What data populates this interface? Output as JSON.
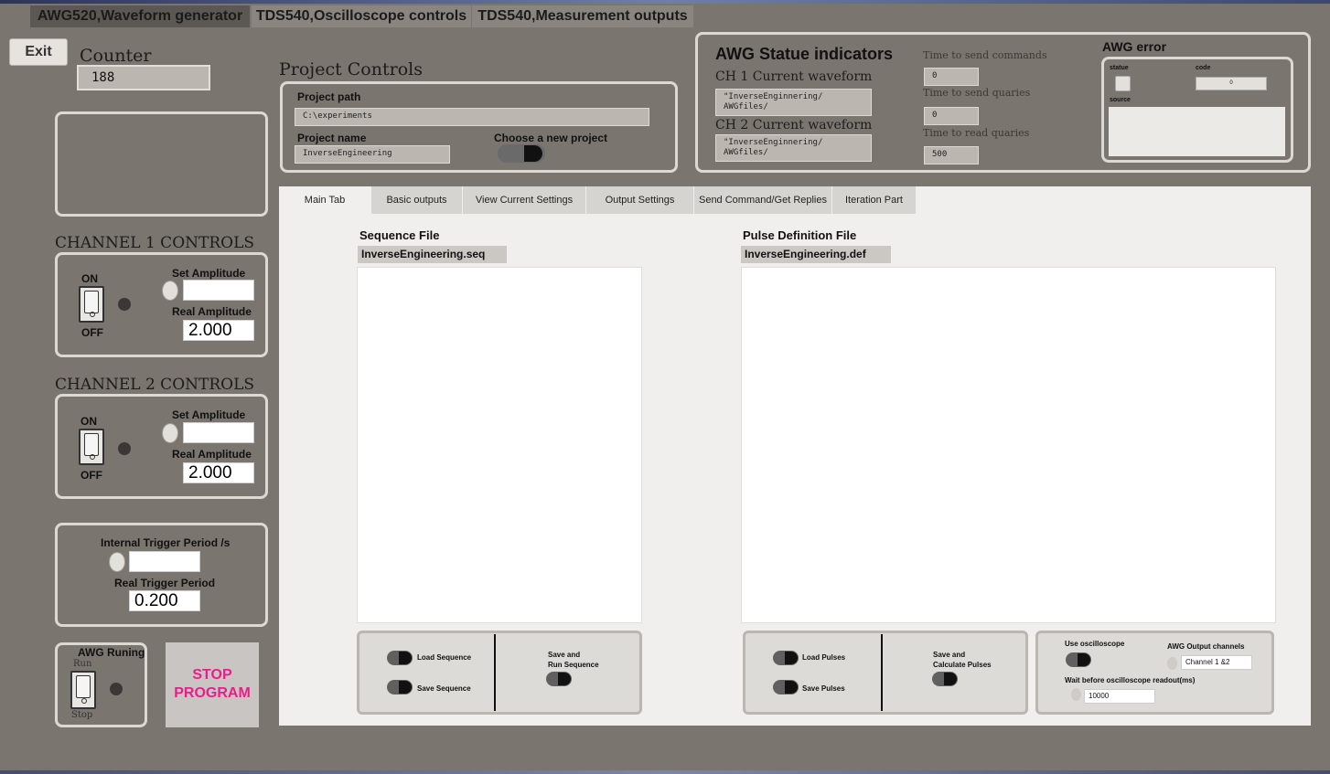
{
  "window_tabs": [
    {
      "label": "AWG520,Waveform generator"
    },
    {
      "label": "TDS540,Oscilloscope controls"
    },
    {
      "label": "TDS540,Measurement outputs"
    }
  ],
  "exit_label": "Exit",
  "counter": {
    "label": "Counter",
    "value": "188"
  },
  "project": {
    "title": "Project Controls",
    "path_label": "Project path",
    "path_value": "C:\\experiments",
    "name_label": "Project name",
    "name_value": "InverseEngineering",
    "choose_label": "Choose a new project"
  },
  "awg_status": {
    "title": "AWG Statue indicators",
    "ch1_label": "CH 1 Current waveform",
    "ch1_value": "\"InverseEnginnering/\nAWGfiles/",
    "ch2_label": "CH 2 Current waveform",
    "ch2_value": "\"InverseEnginnering/\nAWGfiles/",
    "send_cmd_label": "Time to send commands",
    "send_cmd_value": "0",
    "send_q_label": "Time to send quaries",
    "send_q_value": "0",
    "read_q_label": "Time to read quaries",
    "read_q_value": "500"
  },
  "awg_error": {
    "title": "AWG error",
    "statue_label": "statue",
    "code_label": "code",
    "code_value": "0",
    "source_label": "source"
  },
  "channel1": {
    "title": "CHANNEL 1 CONTROLS",
    "on_label": "ON",
    "off_label": "OFF",
    "set_amp_label": "Set Amplitude",
    "real_amp_label": "Real Amplitude",
    "real_amp_value": "2.000"
  },
  "channel2": {
    "title": "CHANNEL 2 CONTROLS",
    "on_label": "ON",
    "off_label": "OFF",
    "set_amp_label": "Set Amplitude",
    "real_amp_label": "Real Amplitude",
    "real_amp_value": "2.000"
  },
  "trigger": {
    "internal_label": "Internal Trigger Period /s",
    "real_label": "Real Trigger Period",
    "real_value": "0.200"
  },
  "awg_running": {
    "label": "AWG Runing",
    "run_label": "Run",
    "stop_label": "Stop"
  },
  "stop_program": {
    "line1": "STOP",
    "line2": "PROGRAM"
  },
  "tabs": [
    {
      "label": "Main Tab",
      "active": true
    },
    {
      "label": "Basic outputs"
    },
    {
      "label": "View Current Settings"
    },
    {
      "label": "Output Settings"
    },
    {
      "label": "Send Command/Get Replies"
    },
    {
      "label": "Iteration Part"
    }
  ],
  "sequence": {
    "title": "Sequence File",
    "file": "InverseEngineering.seq",
    "load_label": "Load Sequence",
    "save_label": "Save Sequence",
    "save_run_label": "Save and\nRun Sequence"
  },
  "pulse": {
    "title": "Pulse Definition File",
    "file": "InverseEngineering.def",
    "load_label": "Load Pulses",
    "save_label": "Save Pulses",
    "save_calc_label": "Save and\nCalculate Pulses"
  },
  "osc": {
    "use_label": "Use oscilloscope",
    "channels_label": "AWG Output channels",
    "channels_value": "Channel 1 &2",
    "wait_label": "Wait before oscilloscope readout(ms)",
    "wait_value": "10000"
  }
}
